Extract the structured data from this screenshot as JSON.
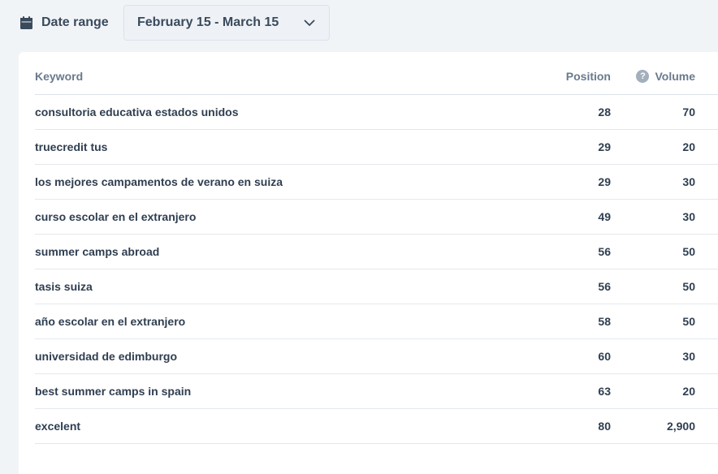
{
  "toolbar": {
    "date_label": "Date range",
    "date_value": "February 15 - March 15",
    "calendar_icon": "calendar-icon",
    "chevron_icon": "chevron-down-icon"
  },
  "table": {
    "headers": {
      "keyword": "Keyword",
      "position": "Position",
      "volume": "Volume",
      "help_icon_glyph": "?"
    },
    "rows": [
      {
        "keyword": "consultoria educativa estados unidos",
        "position": "28",
        "volume": "70"
      },
      {
        "keyword": "truecredit tus",
        "position": "29",
        "volume": "20"
      },
      {
        "keyword": "los mejores campamentos de verano en suiza",
        "position": "29",
        "volume": "30"
      },
      {
        "keyword": "curso escolar en el extranjero",
        "position": "49",
        "volume": "30"
      },
      {
        "keyword": "summer camps abroad",
        "position": "56",
        "volume": "50"
      },
      {
        "keyword": "tasis suiza",
        "position": "56",
        "volume": "50"
      },
      {
        "keyword": "año escolar en el extranjero",
        "position": "58",
        "volume": "50"
      },
      {
        "keyword": "universidad de edimburgo",
        "position": "60",
        "volume": "30"
      },
      {
        "keyword": "best summer camps in spain",
        "position": "63",
        "volume": "20"
      },
      {
        "keyword": "excelent",
        "position": "80",
        "volume": "2,900"
      }
    ]
  },
  "colors": {
    "background": "#f1f4f7",
    "card": "#ffffff",
    "text": "#2f3e50",
    "muted": "#6a7a8c"
  }
}
